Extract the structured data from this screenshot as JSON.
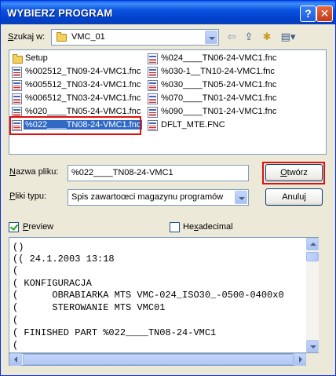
{
  "window": {
    "title": "WYBIERZ PROGRAM",
    "help_glyph": "?",
    "close_glyph": "✕"
  },
  "look_in": {
    "label_underlined": "S",
    "label_rest": "zukaj w:",
    "value": "VMC_01"
  },
  "toolbar": {
    "back_glyph": "⇦",
    "up_glyph": "⇪",
    "newfolder_glyph": "✱",
    "view_glyph": "▤▾"
  },
  "files": {
    "col1": [
      {
        "name": "Setup",
        "type": "folder"
      },
      {
        "name": "%002512_TN09-24-VMC1.fnc",
        "type": "file"
      },
      {
        "name": "%005512_TN03-24-VMC1.fnc",
        "type": "file"
      },
      {
        "name": "%006512_TN03-24-VMC1.fnc",
        "type": "file"
      },
      {
        "name": "%020____TN05-24-VMC1.fnc",
        "type": "file"
      },
      {
        "name": "%022____TN08-24-VMC1.fnc",
        "type": "file",
        "selected": true
      }
    ],
    "col2": [
      {
        "name": "%024____TN06-24-VMC1.fnc",
        "type": "file"
      },
      {
        "name": "%030-1__TN10-24-VMC1.fnc",
        "type": "file"
      },
      {
        "name": "%030____TN05-24-VMC1.fnc",
        "type": "file"
      },
      {
        "name": "%070____TN01-24-VMC1.fnc",
        "type": "file"
      },
      {
        "name": "%090____TN01-24-VMC1.fnc",
        "type": "file"
      },
      {
        "name": "DFLT_MTE.FNC",
        "type": "file"
      }
    ]
  },
  "filename": {
    "label_underlined": "N",
    "label_rest": "azwa pliku:",
    "value": "%022____TN08-24-VMC1"
  },
  "filetype": {
    "label_underlined": "P",
    "label_rest": "liki typu:",
    "value": "Spis zawartoœci magazynu programów"
  },
  "buttons": {
    "open_underlined": "O",
    "open_rest": "twórz",
    "cancel": "Anuluj"
  },
  "options": {
    "preview_underlined": "P",
    "preview_rest": "review",
    "preview_checked": true,
    "hex_pre": "He",
    "hex_underlined": "x",
    "hex_rest": "adecimal",
    "hex_checked": false
  },
  "preview_lines": [
    "()",
    "(( 24.1.2003 13:18",
    "(",
    "( KONFIGURACJA",
    "(      OBRABIARKA MTS VMC-024_ISO30_-0500-0400x0",
    "(      STEROWANIE MTS VMC01",
    "(",
    "( FINISHED PART %022____TN08-24-VMC1",
    "("
  ]
}
